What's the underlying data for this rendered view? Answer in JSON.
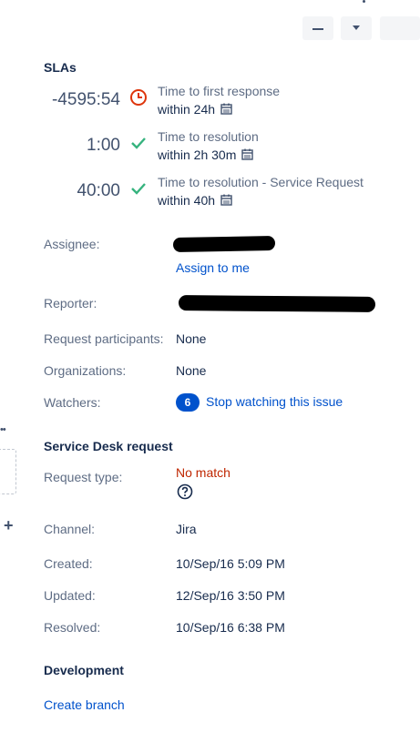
{
  "toolbar": {
    "buttons": [
      "minimize-icon",
      "download-icon",
      "more-icon"
    ]
  },
  "left_gutter": {
    "ellipsis": "••",
    "plus": "+"
  },
  "slas": {
    "title": "SLAs",
    "items": [
      {
        "time": "-4595:54",
        "status": "breached",
        "status_color": "#de350b",
        "name": "Time to first response",
        "goal": "within 24h"
      },
      {
        "time": "1:00",
        "status": "met",
        "status_color": "#36b37e",
        "name": "Time to resolution",
        "goal": "within 2h 30m"
      },
      {
        "time": "40:00",
        "status": "met",
        "status_color": "#36b37e",
        "name": "Time to resolution - Service Request",
        "goal": "within 40h"
      }
    ]
  },
  "people": {
    "assignee_label": "Assignee:",
    "assign_to_me": "Assign to me",
    "reporter_label": "Reporter:",
    "participants_label": "Request participants:",
    "participants_value": "None",
    "organizations_label": "Organizations:",
    "organizations_value": "None",
    "watchers_label": "Watchers:",
    "watchers_count": "6",
    "watchers_action": "Stop watching this issue"
  },
  "service_desk": {
    "title": "Service Desk request",
    "request_type_label": "Request type:",
    "request_type_value": "No match",
    "help_icon": "question-circle-icon",
    "channel_label": "Channel:",
    "channel_value": "Jira",
    "created_label": "Created:",
    "created_value": "10/Sep/16 5:09 PM",
    "updated_label": "Updated:",
    "updated_value": "12/Sep/16 3:50 PM",
    "resolved_label": "Resolved:",
    "resolved_value": "10/Sep/16 6:38 PM"
  },
  "development": {
    "title": "Development",
    "create_branch": "Create branch"
  },
  "colors": {
    "link": "#0052cc",
    "breached": "#de350b",
    "met": "#36b37e",
    "error_text": "#bf2600"
  }
}
